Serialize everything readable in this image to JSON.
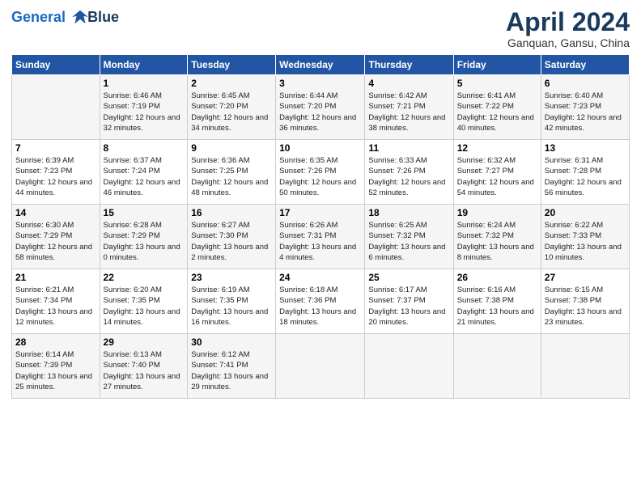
{
  "header": {
    "logo_line1": "General",
    "logo_line2": "Blue",
    "month": "April 2024",
    "location": "Ganquan, Gansu, China"
  },
  "weekdays": [
    "Sunday",
    "Monday",
    "Tuesday",
    "Wednesday",
    "Thursday",
    "Friday",
    "Saturday"
  ],
  "weeks": [
    [
      {
        "day": "",
        "sunrise": "",
        "sunset": "",
        "daylight": ""
      },
      {
        "day": "1",
        "sunrise": "Sunrise: 6:46 AM",
        "sunset": "Sunset: 7:19 PM",
        "daylight": "Daylight: 12 hours and 32 minutes."
      },
      {
        "day": "2",
        "sunrise": "Sunrise: 6:45 AM",
        "sunset": "Sunset: 7:20 PM",
        "daylight": "Daylight: 12 hours and 34 minutes."
      },
      {
        "day": "3",
        "sunrise": "Sunrise: 6:44 AM",
        "sunset": "Sunset: 7:20 PM",
        "daylight": "Daylight: 12 hours and 36 minutes."
      },
      {
        "day": "4",
        "sunrise": "Sunrise: 6:42 AM",
        "sunset": "Sunset: 7:21 PM",
        "daylight": "Daylight: 12 hours and 38 minutes."
      },
      {
        "day": "5",
        "sunrise": "Sunrise: 6:41 AM",
        "sunset": "Sunset: 7:22 PM",
        "daylight": "Daylight: 12 hours and 40 minutes."
      },
      {
        "day": "6",
        "sunrise": "Sunrise: 6:40 AM",
        "sunset": "Sunset: 7:23 PM",
        "daylight": "Daylight: 12 hours and 42 minutes."
      }
    ],
    [
      {
        "day": "7",
        "sunrise": "Sunrise: 6:39 AM",
        "sunset": "Sunset: 7:23 PM",
        "daylight": "Daylight: 12 hours and 44 minutes."
      },
      {
        "day": "8",
        "sunrise": "Sunrise: 6:37 AM",
        "sunset": "Sunset: 7:24 PM",
        "daylight": "Daylight: 12 hours and 46 minutes."
      },
      {
        "day": "9",
        "sunrise": "Sunrise: 6:36 AM",
        "sunset": "Sunset: 7:25 PM",
        "daylight": "Daylight: 12 hours and 48 minutes."
      },
      {
        "day": "10",
        "sunrise": "Sunrise: 6:35 AM",
        "sunset": "Sunset: 7:26 PM",
        "daylight": "Daylight: 12 hours and 50 minutes."
      },
      {
        "day": "11",
        "sunrise": "Sunrise: 6:33 AM",
        "sunset": "Sunset: 7:26 PM",
        "daylight": "Daylight: 12 hours and 52 minutes."
      },
      {
        "day": "12",
        "sunrise": "Sunrise: 6:32 AM",
        "sunset": "Sunset: 7:27 PM",
        "daylight": "Daylight: 12 hours and 54 minutes."
      },
      {
        "day": "13",
        "sunrise": "Sunrise: 6:31 AM",
        "sunset": "Sunset: 7:28 PM",
        "daylight": "Daylight: 12 hours and 56 minutes."
      }
    ],
    [
      {
        "day": "14",
        "sunrise": "Sunrise: 6:30 AM",
        "sunset": "Sunset: 7:29 PM",
        "daylight": "Daylight: 12 hours and 58 minutes."
      },
      {
        "day": "15",
        "sunrise": "Sunrise: 6:28 AM",
        "sunset": "Sunset: 7:29 PM",
        "daylight": "Daylight: 13 hours and 0 minutes."
      },
      {
        "day": "16",
        "sunrise": "Sunrise: 6:27 AM",
        "sunset": "Sunset: 7:30 PM",
        "daylight": "Daylight: 13 hours and 2 minutes."
      },
      {
        "day": "17",
        "sunrise": "Sunrise: 6:26 AM",
        "sunset": "Sunset: 7:31 PM",
        "daylight": "Daylight: 13 hours and 4 minutes."
      },
      {
        "day": "18",
        "sunrise": "Sunrise: 6:25 AM",
        "sunset": "Sunset: 7:32 PM",
        "daylight": "Daylight: 13 hours and 6 minutes."
      },
      {
        "day": "19",
        "sunrise": "Sunrise: 6:24 AM",
        "sunset": "Sunset: 7:32 PM",
        "daylight": "Daylight: 13 hours and 8 minutes."
      },
      {
        "day": "20",
        "sunrise": "Sunrise: 6:22 AM",
        "sunset": "Sunset: 7:33 PM",
        "daylight": "Daylight: 13 hours and 10 minutes."
      }
    ],
    [
      {
        "day": "21",
        "sunrise": "Sunrise: 6:21 AM",
        "sunset": "Sunset: 7:34 PM",
        "daylight": "Daylight: 13 hours and 12 minutes."
      },
      {
        "day": "22",
        "sunrise": "Sunrise: 6:20 AM",
        "sunset": "Sunset: 7:35 PM",
        "daylight": "Daylight: 13 hours and 14 minutes."
      },
      {
        "day": "23",
        "sunrise": "Sunrise: 6:19 AM",
        "sunset": "Sunset: 7:35 PM",
        "daylight": "Daylight: 13 hours and 16 minutes."
      },
      {
        "day": "24",
        "sunrise": "Sunrise: 6:18 AM",
        "sunset": "Sunset: 7:36 PM",
        "daylight": "Daylight: 13 hours and 18 minutes."
      },
      {
        "day": "25",
        "sunrise": "Sunrise: 6:17 AM",
        "sunset": "Sunset: 7:37 PM",
        "daylight": "Daylight: 13 hours and 20 minutes."
      },
      {
        "day": "26",
        "sunrise": "Sunrise: 6:16 AM",
        "sunset": "Sunset: 7:38 PM",
        "daylight": "Daylight: 13 hours and 21 minutes."
      },
      {
        "day": "27",
        "sunrise": "Sunrise: 6:15 AM",
        "sunset": "Sunset: 7:38 PM",
        "daylight": "Daylight: 13 hours and 23 minutes."
      }
    ],
    [
      {
        "day": "28",
        "sunrise": "Sunrise: 6:14 AM",
        "sunset": "Sunset: 7:39 PM",
        "daylight": "Daylight: 13 hours and 25 minutes."
      },
      {
        "day": "29",
        "sunrise": "Sunrise: 6:13 AM",
        "sunset": "Sunset: 7:40 PM",
        "daylight": "Daylight: 13 hours and 27 minutes."
      },
      {
        "day": "30",
        "sunrise": "Sunrise: 6:12 AM",
        "sunset": "Sunset: 7:41 PM",
        "daylight": "Daylight: 13 hours and 29 minutes."
      },
      {
        "day": "",
        "sunrise": "",
        "sunset": "",
        "daylight": ""
      },
      {
        "day": "",
        "sunrise": "",
        "sunset": "",
        "daylight": ""
      },
      {
        "day": "",
        "sunrise": "",
        "sunset": "",
        "daylight": ""
      },
      {
        "day": "",
        "sunrise": "",
        "sunset": "",
        "daylight": ""
      }
    ]
  ]
}
